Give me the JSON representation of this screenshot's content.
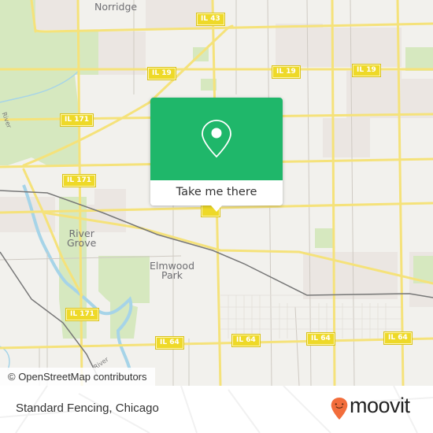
{
  "map": {
    "places": [
      {
        "name": "Norridge",
        "lines": [
          "Norridge"
        ]
      },
      {
        "name": "River Grove",
        "lines": [
          "River",
          "Grove"
        ]
      },
      {
        "name": "Elmwood Park",
        "lines": [
          "Elmwood",
          "Park"
        ]
      }
    ],
    "shields": {
      "il43": "IL 43",
      "il19_a": "IL 19",
      "il19_b": "IL 19",
      "il19_c": "IL 19",
      "il171_a": "IL 171",
      "il171_b": "IL 171",
      "il171_c": "IL 171",
      "il64_a": "IL 64",
      "il64_b": "IL 64",
      "il64_c": "IL 64",
      "il64_d": "IL 64"
    },
    "river_labels": {
      "left": "River",
      "bottom": "River"
    },
    "attribution": "© OpenStreetMap contributors",
    "colors": {
      "land": "#f2f1ed",
      "park": "#d6e8bf",
      "urban": "#ebe6e2",
      "road": "#f5e27a",
      "water": "#a6d4e8",
      "rail": "#777777"
    }
  },
  "popup": {
    "action_label": "Take me there",
    "icon": "location-pin-icon",
    "color": "#1fb76a"
  },
  "footer": {
    "place_name": "Standard Fencing, Chicago",
    "brand": "moovit",
    "brand_color": "#f26d3b"
  }
}
